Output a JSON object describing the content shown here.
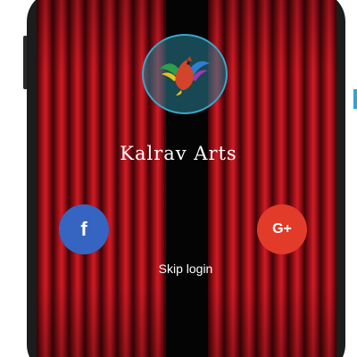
{
  "app": {
    "title": "Kalrav Arts"
  },
  "logo": {
    "icon": "bird-logo-icon"
  },
  "login": {
    "facebook_label": "f",
    "google_label": "G+",
    "skip_label": "Skip login"
  },
  "colors": {
    "curtain": "#b8141e",
    "facebook": "#3565c1",
    "google": "#e23b2a",
    "logo_ring": "#3aa6c8"
  }
}
